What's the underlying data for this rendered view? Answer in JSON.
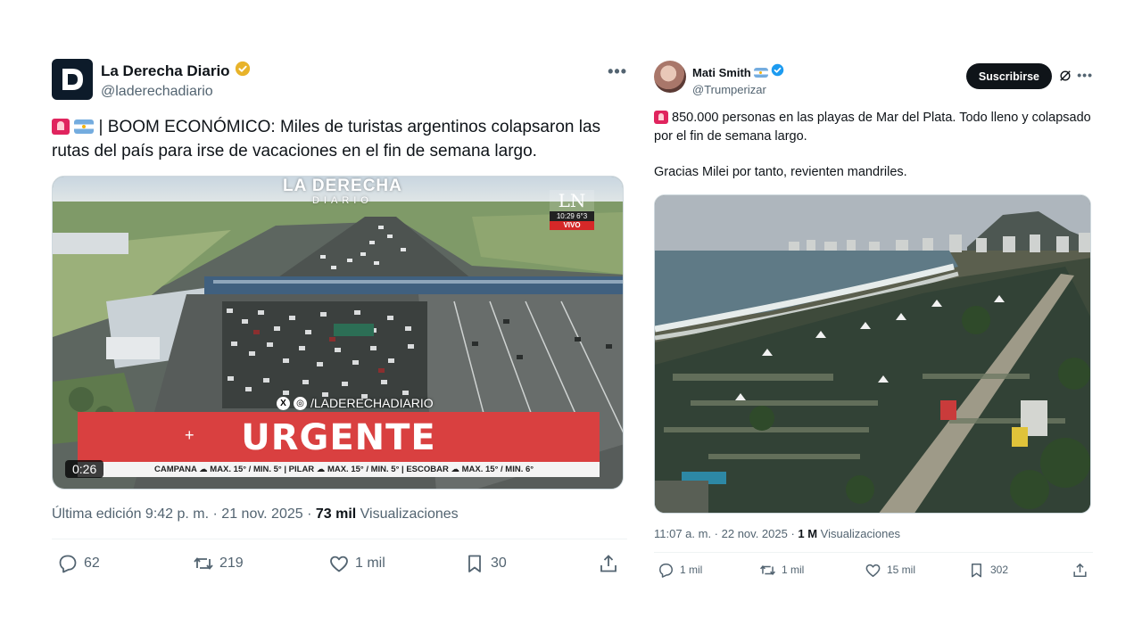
{
  "left_tweet": {
    "author_name": "La Derecha Diario",
    "author_handle": "@laderechadiario",
    "text": " | BOOM ECONÓMICO: Miles de turistas argentinos colapsaron las rutas del país para irse de vacaciones en el fin de semana largo.",
    "video": {
      "duration": "0:26",
      "logo_top": "LA DERECHA",
      "logo_bottom": "DIARIO",
      "channel_letters": "LN",
      "channel_time": "10:29 6°3",
      "channel_live": "VIVO",
      "overlay_handle": "/LADERECHADIARIO",
      "banner": "URGENTE",
      "weather_ticker": "CAMPANA ☁ MAX. 15° / MIN. 5°  |  PILAR ☁ MAX. 15° / MIN. 5°  |  ESCOBAR ☁ MAX. 15° / MIN. 6°"
    },
    "meta_prefix": "Última edición 9:42 p. m. · 21 nov. 2025 · ",
    "views_count": "73 mil",
    "views_label": " Visualizaciones",
    "stats": {
      "replies": "62",
      "reposts": "219",
      "likes": "1 mil",
      "bookmarks": "30"
    }
  },
  "right_tweet": {
    "author_name": "Mati Smith",
    "author_handle": "@Trumperizar",
    "subscribe_label": "Suscribirse",
    "text_line1": " 850.000 personas en las playas de Mar del Plata. Todo lleno y colapsado por el fin de semana largo.",
    "text_line2": "Gracias Milei por tanto, revienten mandriles.",
    "meta_prefix": "11:07 a. m. · 22 nov. 2025 · ",
    "views_count": "1 M",
    "views_label": " Visualizaciones",
    "stats": {
      "replies": "1 mil",
      "reposts": "1 mil",
      "likes": "15 mil",
      "bookmarks": "302"
    }
  },
  "colors": {
    "verified_gold": "#e8b32a",
    "verified_blue": "#1d9bf0",
    "muted_text": "#536471",
    "banner_red": "#d94040"
  },
  "icons": [
    "more-icon",
    "verified-icon",
    "siren-emoji",
    "argentina-flag",
    "reply-icon",
    "repost-icon",
    "like-icon",
    "bookmark-icon",
    "share-icon",
    "grok-icon"
  ]
}
